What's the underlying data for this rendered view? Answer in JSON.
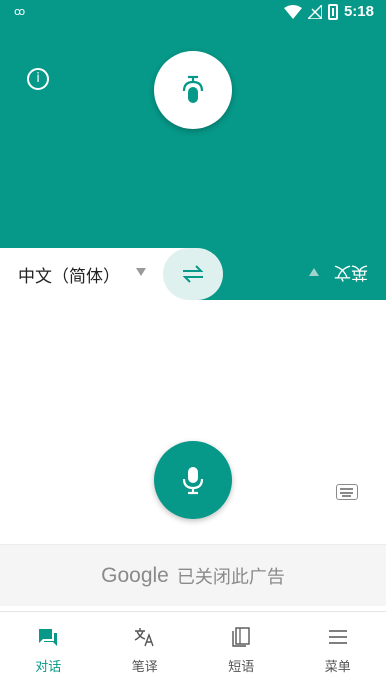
{
  "status_bar": {
    "time": "5:18",
    "left_badge": "ꝏ"
  },
  "top_panel": {
    "info_label": "i"
  },
  "language_bar": {
    "source_language": "中文（简体）",
    "target_language": "英文"
  },
  "ad": {
    "logo": "Google",
    "text": "已关闭此广告"
  },
  "bottom_nav": {
    "items": [
      {
        "label": "对话",
        "icon": "conversation-icon",
        "active": true
      },
      {
        "label": "笔译",
        "icon": "translate-icon",
        "active": false
      },
      {
        "label": "短语",
        "icon": "phrasebook-icon",
        "active": false
      },
      {
        "label": "菜单",
        "icon": "menu-icon",
        "active": false
      }
    ]
  },
  "colors": {
    "accent": "#069888",
    "accent_light": "#dff1ee"
  }
}
